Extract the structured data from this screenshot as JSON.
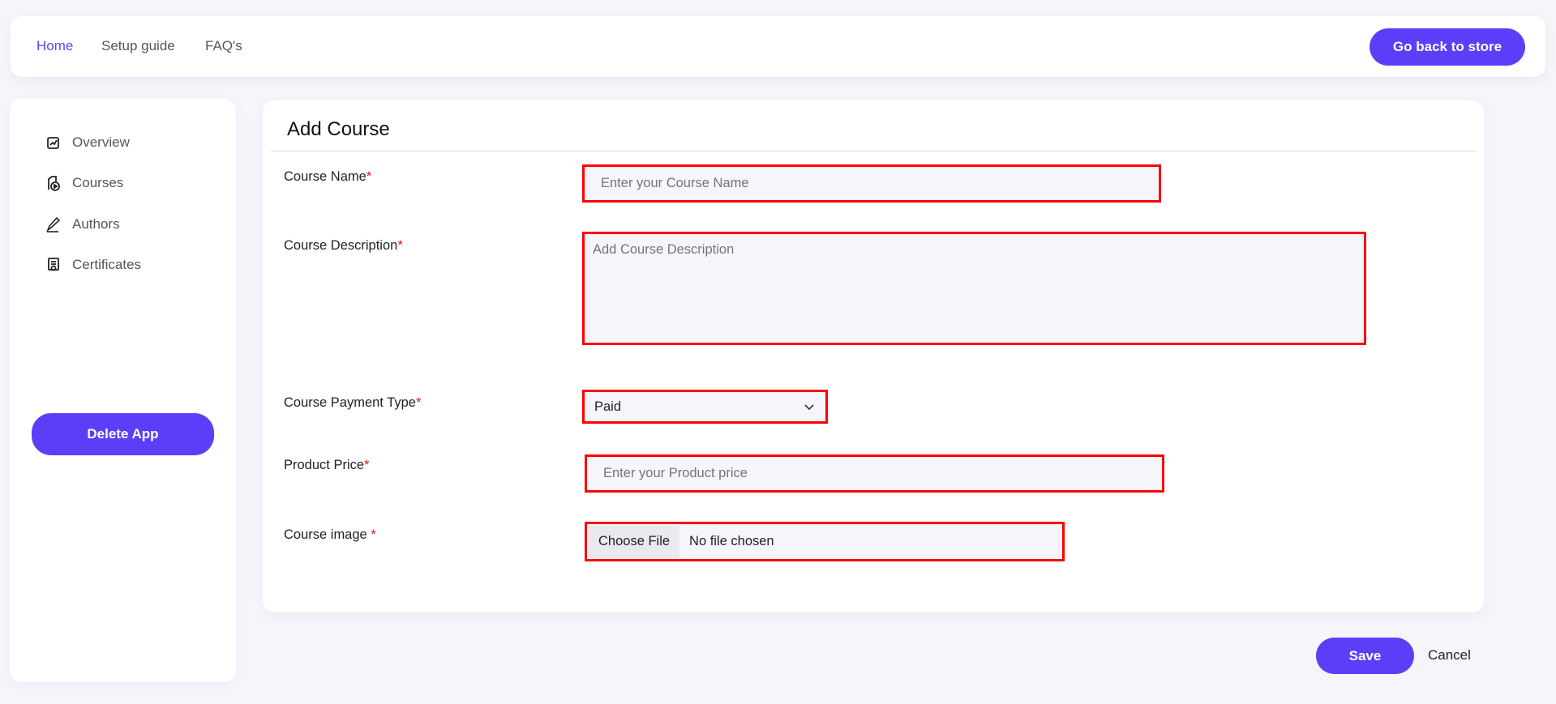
{
  "nav": {
    "links": [
      "Home",
      "Setup guide",
      "FAQ's"
    ],
    "back_button": "Go back to store"
  },
  "sidebar": {
    "items": [
      {
        "label": "Overview",
        "icon": "chart-edit-icon"
      },
      {
        "label": "Courses",
        "icon": "course-video-icon"
      },
      {
        "label": "Authors",
        "icon": "pen-icon"
      },
      {
        "label": "Certificates",
        "icon": "certificate-icon"
      }
    ],
    "delete_button": "Delete App"
  },
  "form": {
    "title": "Add Course",
    "required_mark": "*",
    "course_name": {
      "label": "Course Name",
      "placeholder": "Enter your Course Name"
    },
    "description": {
      "label": "Course Description",
      "placeholder": "Add Course Description"
    },
    "payment_type": {
      "label": "Course Payment Type",
      "value": "Paid"
    },
    "price": {
      "label": "Product Price",
      "placeholder": "Enter your Product price"
    },
    "image": {
      "label": "Course image ",
      "button": "Choose File",
      "status": "No file chosen"
    }
  },
  "actions": {
    "save": "Save",
    "cancel": "Cancel"
  },
  "colors": {
    "accent": "#5b3ff8",
    "highlight": "#ff0000"
  }
}
